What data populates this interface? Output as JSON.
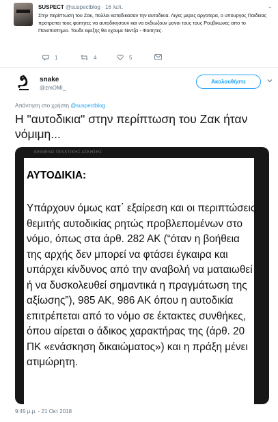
{
  "parent_tweet": {
    "name": "SUSPECT",
    "handle": "@suspectblog",
    "time": "· 16 λεπ.",
    "text": "Στην περίπτωση του Ζακ, πολλοι καταδικασαν την αυτοδικια. Λιγες μερες αργοτερα, ο υπουργος Παιδειας προτρεπει τους φοιτητες να αυτοδικησουν και να εκδιωξουν μονοι τους τους Ρουβικωνες απο το Πανεπιστημιο. Τουδε εφεξης θα εχουμε Νιντζα - Φοιτητες.",
    "actions": {
      "reply_count": "1",
      "retweet_count": "4",
      "like_count": "5"
    },
    "caret_icon": "chevron-down-icon"
  },
  "main_tweet": {
    "name": "snake",
    "handle": "@zmOMI_",
    "follow_label": "Ακολουθήστε",
    "reply_to_prefix": "Απάντηση στο χρήστη",
    "reply_to_handle": "@suspectblog",
    "text": "Η \"αυτοδικια\" στην περίπτωση του Ζακ ήταν νόμιμη...",
    "timestamp": "9:45 μ.μ. - 21 Οκτ 2018",
    "media": {
      "top_strip": "ΚΕΙΜΕΝΟ ΠΡΑΚΤΙΚΗΣ ΑΣΚΗΣΗΣ",
      "heading": "ΑΥΤΟΔΙΚΙΑ:",
      "body": "Υπάρχουν όμως κατ΄ εξαίρεση και οι περιπτώσεις θεμιτής αυτοδικίας ρητώς προβλεπομένων στο νόμο, όπως στα άρθ. 282 ΑΚ (“όταν η βοήθεια της αρχής δεν μπορεί να φτάσει έγκαιρα και υπάρχει κίνδυνος από την αναβολή να ματαιωθεί ή να δυσκολευθεί σημαντικά η πραγμάτωση της αξίωσης”), 985 ΑΚ, 986 ΑΚ  όπου η αυτοδικία επιτρέπεται από το νόμο σε έκτακτες συνθήκες, όπου αίρεται ο άδικος χαρακτήρας της (άρθ. 20 ΠΚ «ενάσκηση δικαιώματος») και η πράξη μένει ατιμώρητη."
    }
  },
  "colors": {
    "accent": "#1da1f2",
    "secondary_text": "#657786",
    "primary_text": "#14171a",
    "like_pink": "#e0245e",
    "retweet_green": "#17bf63"
  }
}
